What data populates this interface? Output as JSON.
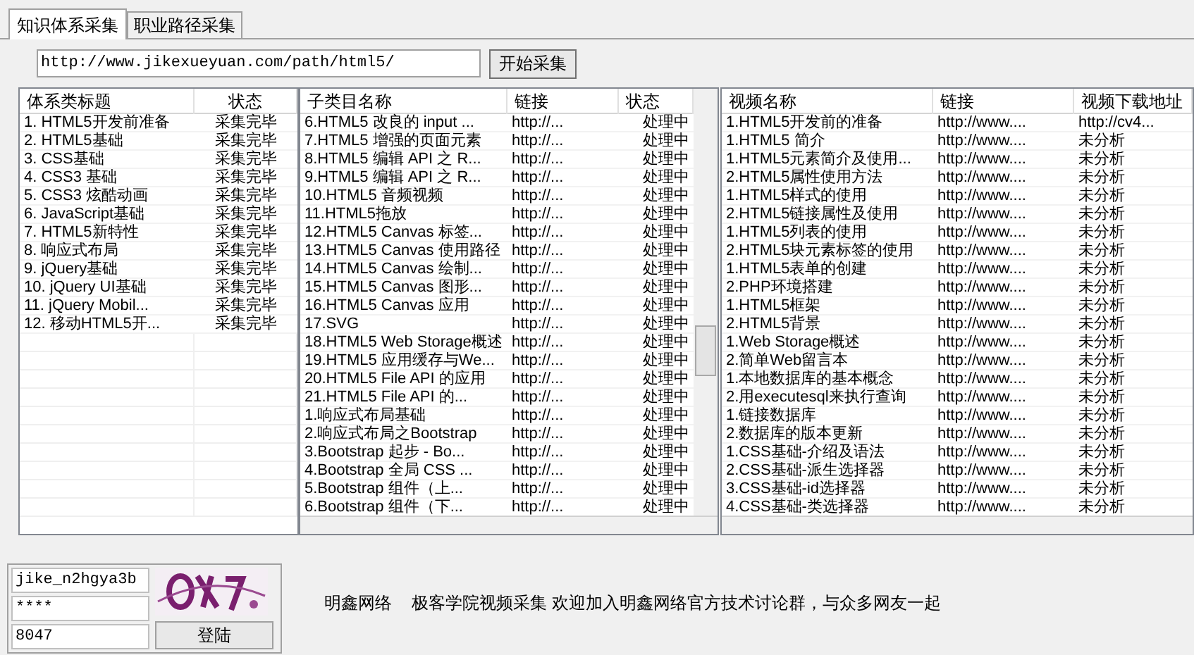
{
  "tabs": [
    {
      "label": "知识体系采集",
      "selected": true
    },
    {
      "label": "职业路径采集",
      "selected": false
    }
  ],
  "url_field": {
    "value": "http://www.jikexueyuan.com/path/html5/"
  },
  "start_button": "开始采集",
  "system_table": {
    "columns": [
      "体系类标题",
      "状态"
    ],
    "rows": [
      [
        "1.  HTML5开发前准备",
        "采集完毕"
      ],
      [
        "2.  HTML5基础",
        "采集完毕"
      ],
      [
        "3.  CSS基础",
        "采集完毕"
      ],
      [
        "4.  CSS3 基础",
        "采集完毕"
      ],
      [
        "5.  CSS3 炫酷动画",
        "采集完毕"
      ],
      [
        "6.  JavaScript基础",
        "采集完毕"
      ],
      [
        "7.  HTML5新特性",
        "采集完毕"
      ],
      [
        "8.  响应式布局",
        "采集完毕"
      ],
      [
        "9.  jQuery基础",
        "采集完毕"
      ],
      [
        "10.  jQuery UI基础",
        "采集完毕"
      ],
      [
        "11.  jQuery Mobil...",
        "采集完毕"
      ],
      [
        "12.  移动HTML5开...",
        "采集完毕"
      ]
    ]
  },
  "subcategory_table": {
    "columns": [
      "子类目名称",
      "链接",
      "状态"
    ],
    "rows": [
      [
        "6.HTML5 改良的 input ...",
        "http://...",
        "处理中"
      ],
      [
        "7.HTML5 增强的页面元素",
        "http://...",
        "处理中"
      ],
      [
        "8.HTML5 编辑 API 之 R...",
        "http://...",
        "处理中"
      ],
      [
        "9.HTML5 编辑 API 之 R...",
        "http://...",
        "处理中"
      ],
      [
        "10.HTML5 音频视频",
        "http://...",
        "处理中"
      ],
      [
        "11.HTML5拖放",
        "http://...",
        "处理中"
      ],
      [
        "12.HTML5 Canvas 标签...",
        "http://...",
        "处理中"
      ],
      [
        "13.HTML5 Canvas 使用路径",
        "http://...",
        "处理中"
      ],
      [
        "14.HTML5 Canvas 绘制...",
        "http://...",
        "处理中"
      ],
      [
        "15.HTML5 Canvas 图形...",
        "http://...",
        "处理中"
      ],
      [
        "16.HTML5 Canvas 应用",
        "http://...",
        "处理中"
      ],
      [
        "17.SVG",
        "http://...",
        "处理中"
      ],
      [
        "18.HTML5 Web Storage概述",
        "http://...",
        "处理中"
      ],
      [
        "19.HTML5 应用缓存与We...",
        "http://...",
        "处理中"
      ],
      [
        "20.HTML5 File API 的应用",
        "http://...",
        "处理中"
      ],
      [
        "21.HTML5 File API 的...",
        "http://...",
        "处理中"
      ],
      [
        "1.响应式布局基础",
        "http://...",
        "处理中"
      ],
      [
        "2.响应式布局之Bootstrap",
        "http://...",
        "处理中"
      ],
      [
        "3.Bootstrap 起步 - Bo...",
        "http://...",
        "处理中"
      ],
      [
        "4.Bootstrap 全局 CSS ...",
        "http://...",
        "处理中"
      ],
      [
        "5.Bootstrap 组件（上...",
        "http://...",
        "处理中"
      ],
      [
        "6.Bootstrap 组件（下...",
        "http://...",
        "处理中"
      ]
    ]
  },
  "video_table": {
    "columns": [
      "视频名称",
      "链接",
      "视频下载地址"
    ],
    "rows": [
      [
        "1.HTML5开发前的准备",
        "http://www....",
        "http://cv4..."
      ],
      [
        "1.HTML5 简介",
        "http://www....",
        "未分析"
      ],
      [
        "1.HTML5元素简介及使用...",
        "http://www....",
        "未分析"
      ],
      [
        "2.HTML5属性使用方法",
        "http://www....",
        "未分析"
      ],
      [
        "1.HTML5样式的使用",
        "http://www....",
        "未分析"
      ],
      [
        "2.HTML5链接属性及使用",
        "http://www....",
        "未分析"
      ],
      [
        "1.HTML5列表的使用",
        "http://www....",
        "未分析"
      ],
      [
        "2.HTML5块元素标签的使用",
        "http://www....",
        "未分析"
      ],
      [
        "1.HTML5表单的创建",
        "http://www....",
        "未分析"
      ],
      [
        "2.PHP环境搭建",
        "http://www....",
        "未分析"
      ],
      [
        "1.HTML5框架",
        "http://www....",
        "未分析"
      ],
      [
        "2.HTML5背景",
        "http://www....",
        "未分析"
      ],
      [
        "1.Web Storage概述",
        "http://www....",
        "未分析"
      ],
      [
        "2.简单Web留言本",
        "http://www....",
        "未分析"
      ],
      [
        "1.本地数据库的基本概念",
        "http://www....",
        "未分析"
      ],
      [
        "2.用executesql来执行查询",
        "http://www....",
        "未分析"
      ],
      [
        "1.链接数据库",
        "http://www....",
        "未分析"
      ],
      [
        "2.数据库的版本更新",
        "http://www....",
        "未分析"
      ],
      [
        "1.CSS基础-介绍及语法",
        "http://www....",
        "未分析"
      ],
      [
        "2.CSS基础-派生选择器",
        "http://www....",
        "未分析"
      ],
      [
        "3.CSS基础-id选择器",
        "http://www....",
        "未分析"
      ],
      [
        "4.CSS基础-类选择器",
        "http://www....",
        "未分析"
      ]
    ]
  },
  "login": {
    "username": "jike_n2hgya3b",
    "password": "****",
    "captcha_input": "8047",
    "login_button": "登陆"
  },
  "status_texts": [
    "明鑫网络",
    "极客学院视频采集 欢迎加入明鑫网络官方技术讨论群，与众多网友一起"
  ]
}
